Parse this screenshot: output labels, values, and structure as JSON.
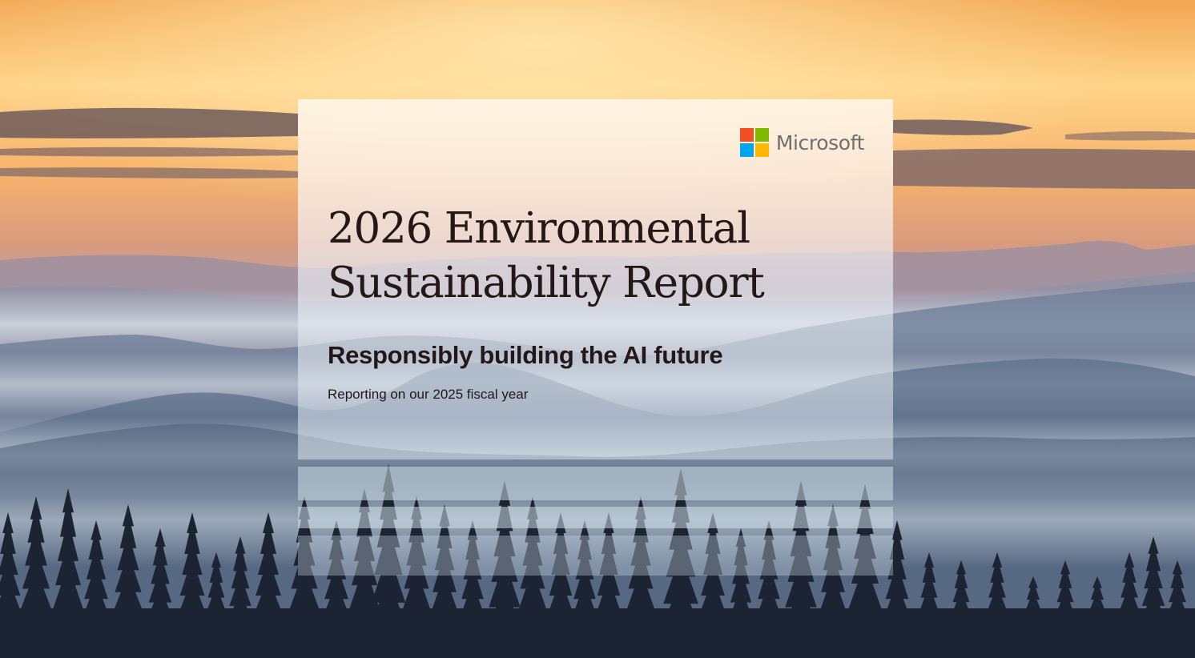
{
  "logo": {
    "wordmark": "Microsoft",
    "colors": [
      "#f25022",
      "#7fba00",
      "#00a4ef",
      "#ffb900"
    ]
  },
  "cover": {
    "title_line_1": "2026 Environmental",
    "title_line_2": "Sustainability Report",
    "subtitle": "Responsibly building the AI future",
    "note": "Reporting on our 2025 fiscal year"
  },
  "palette": {
    "sky_top": "#f4b061",
    "sky_glow": "#ffd98f",
    "mist": "#b7c7d6",
    "forest": "#1d2634",
    "text": "#231717"
  }
}
